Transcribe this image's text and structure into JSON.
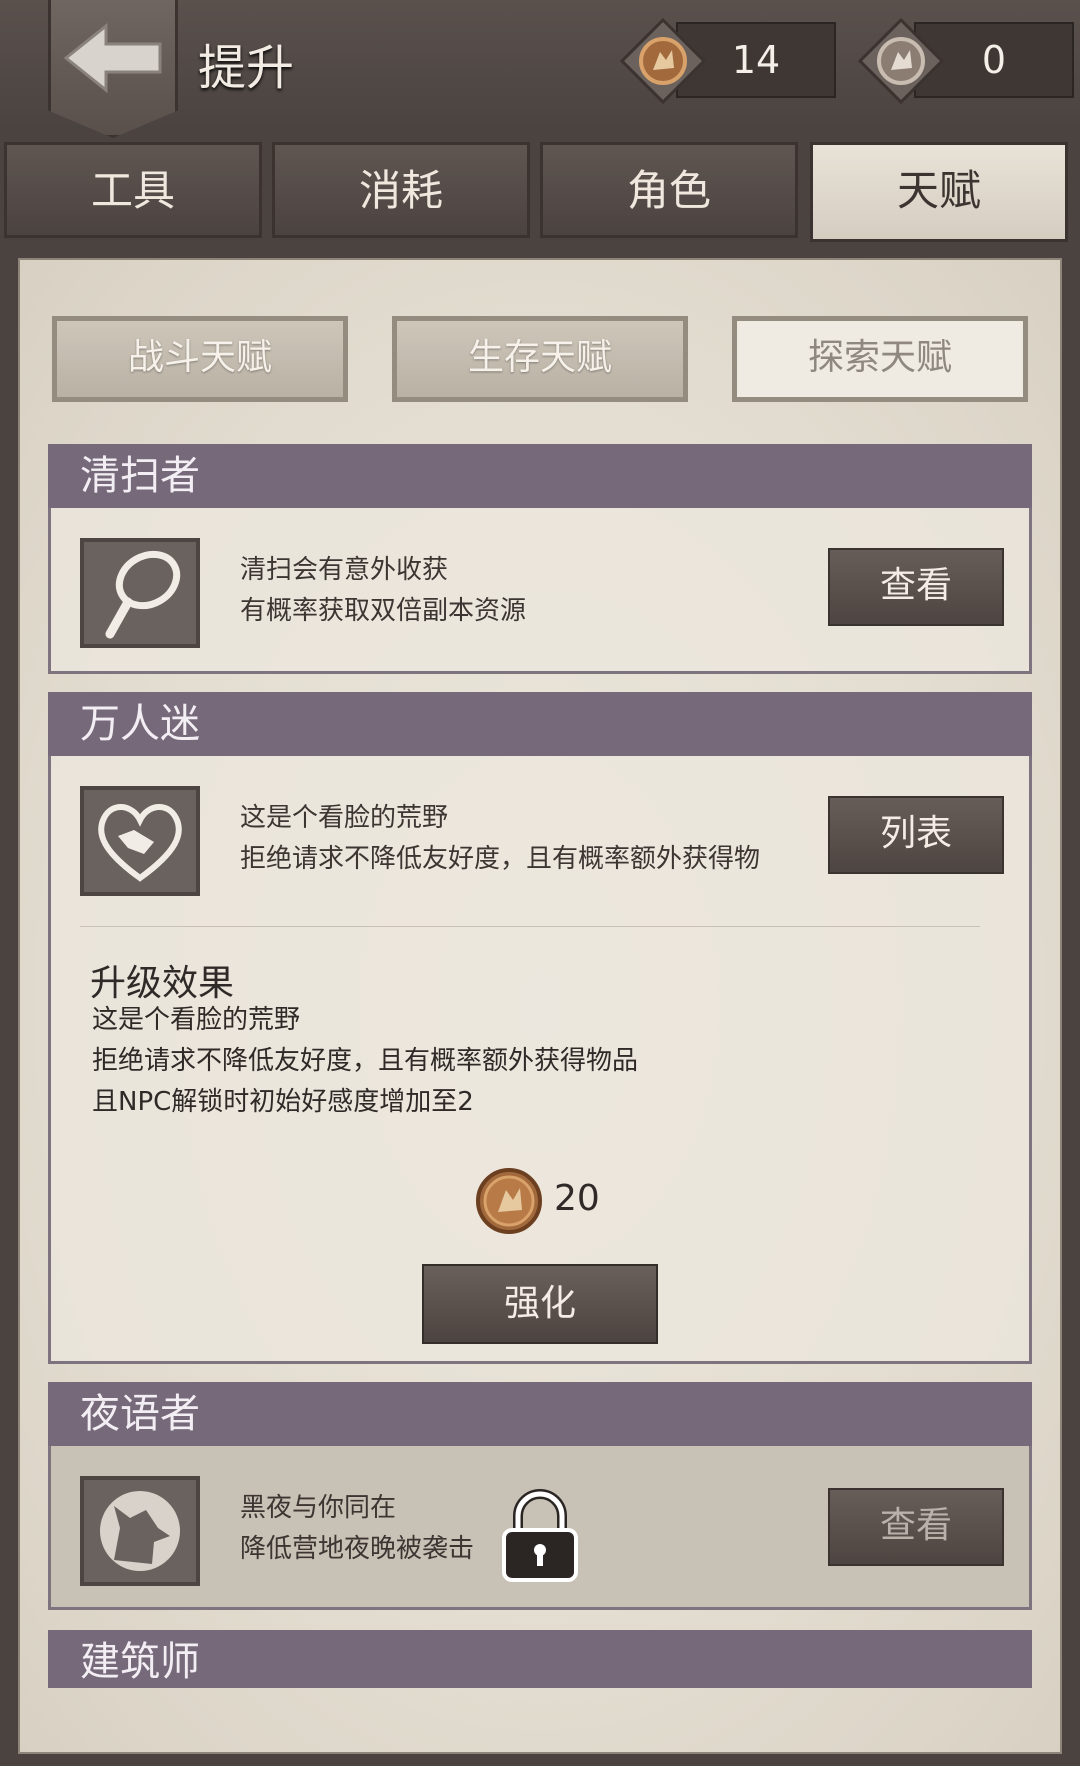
{
  "header": {
    "title": "提升",
    "currencies": [
      {
        "icon": "wolf-coin-icon",
        "value": "14"
      },
      {
        "icon": "wolf-coin-icon",
        "value": "0"
      }
    ]
  },
  "tabs": [
    "工具",
    "消耗",
    "角色",
    "天赋"
  ],
  "active_tab": "天赋",
  "subtabs": [
    "战斗天赋",
    "生存天赋",
    "探索天赋"
  ],
  "active_subtab": "探索天赋",
  "talents": [
    {
      "name": "清扫者",
      "icon": "magnifier-icon",
      "lines": [
        "清扫会有意外收获",
        "有概率获取双倍副本资源"
      ],
      "button": "查看"
    },
    {
      "name": "万人迷",
      "icon": "heart-handshake-icon",
      "lines": [
        "这是个看脸的荒野",
        "拒绝请求不降低友好度，且有概率额外获得物"
      ],
      "button": "列表",
      "upgrade": {
        "title": "升级效果",
        "lines": [
          "这是个看脸的荒野",
          "拒绝请求不降低友好度，且有概率额外获得物品",
          "且NPC解锁时初始好感度增加至2"
        ],
        "cost": "20",
        "action": "强化"
      }
    },
    {
      "name": "夜语者",
      "icon": "wolf-howl-icon",
      "lines": [
        "黑夜与你同在",
        "降低营地夜晚被袭击"
      ],
      "button": "查看",
      "locked": true
    },
    {
      "name": "建筑师"
    }
  ],
  "colors": {
    "section_header": "#76697a",
    "paper": "#e8e2d8",
    "frame": "#4a4340"
  }
}
